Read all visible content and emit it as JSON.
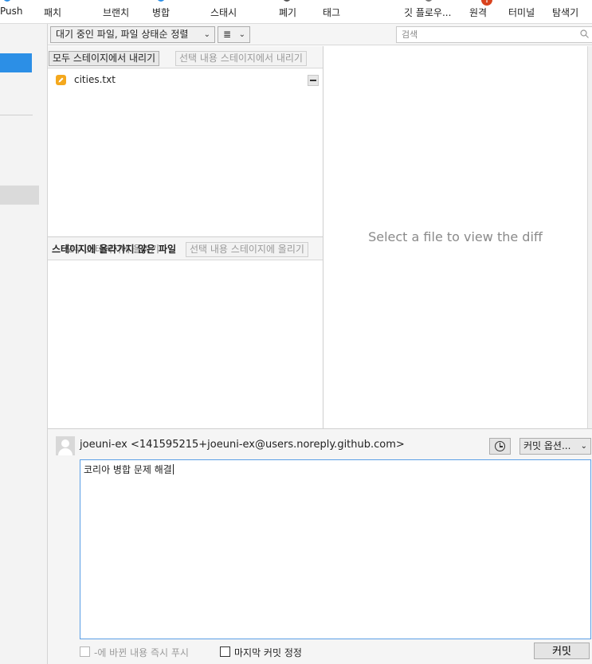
{
  "toolbar": {
    "push": "Push",
    "patch": "패치",
    "branch": "브랜치",
    "merge": "병합",
    "stash": "스태시",
    "discard": "폐기",
    "tag": "태그",
    "git_flow": "깃 플로우...",
    "remote": "원격",
    "remote_badge": "!",
    "terminal": "터미널",
    "explorer": "탐색기",
    "accent_color": "#2c8fe6",
    "badge_color": "#d9431e"
  },
  "filter": {
    "file_filter": "대기 중인 파일, 파일 상태순 정렬",
    "view_mode_icon": "list-icon",
    "search_placeholder": "검색"
  },
  "staged": {
    "unstage_all": "모두 스테이지에서 내리기",
    "unstage_selected": "선택 내용 스테이지에서 내리기",
    "files": [
      {
        "name": "cities.txt",
        "status_icon": "modified-file-icon",
        "status_color": "#f4a81d"
      }
    ]
  },
  "unstaged": {
    "title": "스테이지에 올라가지 않은 파일",
    "title_overlap": "모두 스테이지에 올리기",
    "stage_selected": "선택 내용 스테이지에 올리기"
  },
  "diff": {
    "placeholder": "Select a file to view the diff"
  },
  "commit": {
    "author": "joeuni-ex <141595215+joeuni-ex@users.noreply.github.com>",
    "options": "커밋 옵션...",
    "message": "코리아 병합 문제 해결",
    "push_immediately": "-에 바뀐 내용 즉시 푸시",
    "amend_last": "마지막 커밋 정정",
    "commit_button": "커밋"
  }
}
